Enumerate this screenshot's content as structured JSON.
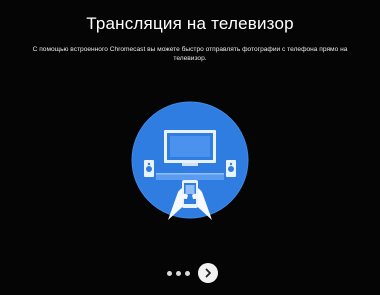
{
  "onboarding": {
    "title": "Трансляция на телевизор",
    "description": "С помощью встроенного Chromecast вы можете быстро отправлять фотографии с телефона прямо на телевизор.",
    "illustration_icon": "phone-casting-to-tv-icon",
    "colors": {
      "background": "#050505",
      "illustration_circle": "#2f7de1",
      "illustration_accent": "#5b9cf0"
    }
  },
  "pager": {
    "dot_count": 3,
    "next_icon": "chevron-right-icon"
  }
}
